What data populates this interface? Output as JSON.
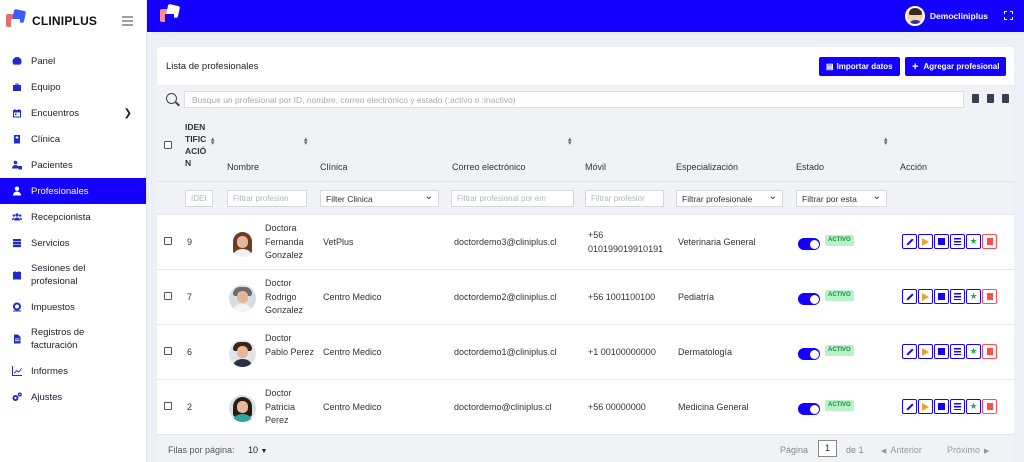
{
  "app": {
    "brand": "CLINIPLUS"
  },
  "sidebar": {
    "items": [
      {
        "label": "Panel",
        "icon": "gauge-icon"
      },
      {
        "label": "Equipo",
        "icon": "briefcase-icon"
      },
      {
        "label": "Encuentros",
        "icon": "calendar-icon",
        "has_submenu": true
      },
      {
        "label": "Clínica",
        "icon": "hospital-icon"
      },
      {
        "label": "Pacientes",
        "icon": "patients-icon"
      },
      {
        "label": "Profesionales",
        "icon": "user-icon",
        "active": true
      },
      {
        "label": "Recepcionista",
        "icon": "users-icon"
      },
      {
        "label": "Servicios",
        "icon": "server-icon"
      },
      {
        "label": "Sesiones del profesional",
        "icon": "calendar-icon"
      },
      {
        "label": "Impuestos",
        "icon": "coin-icon"
      },
      {
        "label": "Registros de facturación",
        "icon": "file-icon"
      },
      {
        "label": "Informes",
        "icon": "chart-icon"
      },
      {
        "label": "Ajustes",
        "icon": "gears-icon"
      }
    ]
  },
  "topbar": {
    "username": "Democliniplus"
  },
  "card": {
    "title": "Lista de profesionales",
    "import_label": "Importar datos",
    "add_label": "Agregar profesional"
  },
  "search": {
    "placeholder": "Busque un profesional por ID, nombre, correo electrónico y estado (:activo o :inactivo)"
  },
  "table": {
    "headers": {
      "id": "IDEN TIFIC ACIÓ N",
      "name": "Nombre",
      "clinic": "Clínica",
      "email": "Correo electrónico",
      "mobile": "Móvil",
      "specialization": "Especialización",
      "status": "Estado",
      "action": "Acción"
    },
    "filters": {
      "id": "IDEI",
      "name": "Filtrar profesion",
      "clinic": "Filter Clinica",
      "email": "Filtrar profesional por em",
      "mobile": "Filtrar profesior",
      "specialization": "Filtrar profesionale",
      "status": "Filtrar por esta"
    },
    "rows": [
      {
        "id": "9",
        "name": "Doctora Fernanda Gonzalez",
        "clinic": "VetPlus",
        "email": "doctordemo3@cliniplus.cl",
        "mobile": "+56 010199019910191",
        "specialization": "Veterinaria General",
        "status": "ACTIVO"
      },
      {
        "id": "7",
        "name": "Doctor Rodrigo Gonzalez",
        "clinic": "Centro Medico",
        "email": "doctordemo2@cliniplus.cl",
        "mobile": "+56 1001100100",
        "specialization": "Pediatría",
        "status": "ACTIVO"
      },
      {
        "id": "6",
        "name": "Doctor Pablo Perez",
        "clinic": "Centro Medico",
        "email": "doctordemo1@cliniplus.cl",
        "mobile": "+1 00100000000",
        "specialization": "Dermatología",
        "status": "ACTIVO"
      },
      {
        "id": "2",
        "name": "Doctor Patricia Perez",
        "clinic": "Centro Medico",
        "email": "doctordemo@cliniplus.cl",
        "mobile": "+56 00000000",
        "specialization": "Medicina General",
        "status": "ACTIVO"
      }
    ]
  },
  "footer": {
    "rows_per_page_label": "Filas por página:",
    "rows_per_page_value": "10",
    "page_label": "Página",
    "page_value": "1",
    "of_label": "de 1",
    "prev_label": "Anterior",
    "next_label": "Próximo"
  },
  "colors": {
    "primary": "#1400ff",
    "danger": "#ff4c4c",
    "success_bg": "#b8f2c8"
  }
}
